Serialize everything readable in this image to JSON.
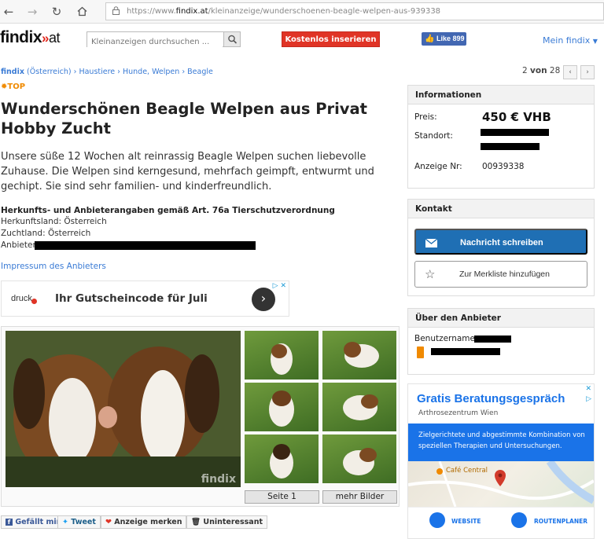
{
  "browser": {
    "url_prefix": "https://www.",
    "url_domain": "findix.at",
    "url_path": "/kleinanzeige/wunderschoenen-beagle-welpen-aus-939338"
  },
  "header": {
    "logo_text": "findix",
    "logo_mark": "»",
    "logo_tld": "at",
    "search_placeholder": "Kleinanzeigen durchsuchen ...",
    "insert_button": "Kostenlos inserieren",
    "fb_like": "Like 899",
    "account_link": "Mein findix"
  },
  "breadcrumb": {
    "site": "findix",
    "country": "(Österreich)",
    "items": [
      "Haustiere",
      "Hunde, Welpen",
      "Beagle"
    ]
  },
  "pager": {
    "current": "2",
    "sep": "von",
    "total": "28"
  },
  "listing": {
    "badge": "TOP",
    "title": "Wunderschönen Beagle Welpen aus Privat Hobby Zucht",
    "description": "Unsere süße 12 Wochen alt reinrassig Beagle Welpen suchen liebevolle Zuhause. Die Welpen sind kerngesund, mehrfach geimpft, entwurmt und gechipt. Sie sind sehr familien- und kinderfreundlich.",
    "origin_heading": "Herkunfts- und Anbieterangaben gemäß Art. 76a Tierschutzverordnung",
    "origin_country": "Herkunftsland: Österreich",
    "breed_country": "Zuchtland: Österreich",
    "provider_label": "Anbieter:",
    "impressum": "Impressum des Anbieters"
  },
  "ad1": {
    "brand": "druck",
    "text": "Ihr Gutscheincode für Juli"
  },
  "gallery": {
    "page_button": "Seite 1",
    "more_button": "mehr Bilder",
    "watermark": "findix"
  },
  "share": {
    "facebook": "Gefällt mir",
    "twitter": "Tweet",
    "favorite": "Anzeige merken",
    "uninterested": "Uninteressant"
  },
  "info_panel": {
    "heading": "Informationen",
    "price_label": "Preis:",
    "price": "450 € VHB",
    "location_label": "Standort:",
    "ad_number_label": "Anzeige Nr:",
    "ad_number": "00939338"
  },
  "contact_panel": {
    "heading": "Kontakt",
    "message_button": "Nachricht schreiben",
    "bookmark_button": "Zur Merkliste hinzufügen"
  },
  "provider_panel": {
    "heading": "Über den Anbieter",
    "username_label": "Benutzername:"
  },
  "ad2": {
    "headline": "Gratis Beratungsgespräch",
    "advertiser": "Arthrosezentrum Wien",
    "body": "Zielgerichtete und abgestimmte Kombination von speziellen Therapien und Untersuchungen.",
    "map_label": "Café Central",
    "website": "WEBSITE",
    "route": "ROUTENPLANER"
  },
  "colors": {
    "brand_red": "#e03426",
    "link_blue": "#3a7bd5",
    "primary_button": "#1f6fb4",
    "top_badge": "#f08a00",
    "ad_blue": "#1a73e8"
  }
}
